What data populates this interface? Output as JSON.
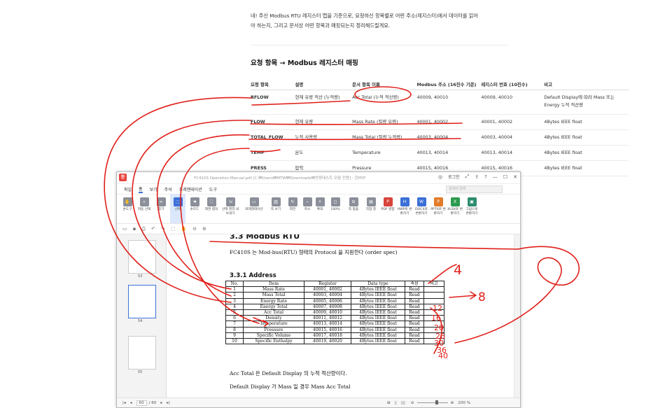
{
  "intro": {
    "line1": "네! 주신 Modbus RTU 레지스터 맵을 기준으로, 요청하신 항목별로 어떤 주소(레지스터)에서 데이터를 읽어",
    "line2": "야 하는지, 그리고 문서상 어떤 항목과 매핑되는지 정리해드릴게요."
  },
  "section_title": "요청 항목 → Modbus 레지스터 매핑",
  "mapping": {
    "headers": [
      "요청 항목",
      "설명",
      "문서 항목 이름",
      "Modbus 주소 (16진수 기준)",
      "레지스터 번호 (10진수)",
      "비고"
    ],
    "rows": [
      [
        "RFLOW",
        "현재 유량 적산 (누적량)",
        "Acc Total (누적 적산량)",
        "40009, 40010",
        "40009, 40010",
        "Default Display에 따라 Mass 또는 Energy 누적 적산량"
      ],
      [
        "FLOW",
        "현재 유량",
        "Mass Rate (질량 유량)",
        "40001, 40002",
        "40001, 40002",
        "4Bytes IEEE float"
      ],
      [
        "TOTAL_FLOW",
        "누적 사용량",
        "Mass Total (질량 누적량)",
        "40003, 40004",
        "40003, 40004",
        "4Bytes IEEE float"
      ],
      [
        "TEMP",
        "온도",
        "Temperature",
        "40013, 40014",
        "40013, 40014",
        "4Bytes IEEE float"
      ],
      [
        "PRESS",
        "압력",
        "Pressure",
        "40015, 40016",
        "40015, 40016",
        "4Bytes IEEE float"
      ]
    ]
  },
  "viewer": {
    "title": "FC410S Operation Manual.pdf [C:₩Users₩MTW₩Downloads₩연동테스트 모음 전용] - 한PDF",
    "login": "로그인",
    "search_placeholder": "검색어 입력",
    "menu": [
      "파일",
      "홈",
      "보기",
      "주석",
      "프레젠테이션",
      "도구"
    ],
    "ribbon": [
      {
        "label": "손도구",
        "icon": "hand-icon"
      },
      {
        "label": "자동 선택",
        "icon": "auto-select-icon"
      },
      {
        "label": "찾기",
        "icon": "binoculars-icon"
      },
      {
        "label": "선택",
        "icon": "select-icon"
      },
      {
        "label": "손모드",
        "icon": "hand-mode-icon"
      },
      {
        "label": "화면 캡처",
        "icon": "capture-icon"
      },
      {
        "label": "선택 영역 내보내기",
        "icon": "export-area-icon"
      },
      {
        "label": "프레젠테이션",
        "icon": "presentation-icon"
      },
      {
        "label": "쪽 보기",
        "icon": "page-view-icon"
      },
      {
        "label": "회전",
        "icon": "rotate-icon"
      },
      {
        "label": "축소",
        "icon": "zoom-out-icon"
      },
      {
        "label": "확대",
        "icon": "zoom-in-icon"
      },
      {
        "label": "100%",
        "icon": "zoom-100-icon"
      },
      {
        "label": "쪽 맞춤",
        "icon": "fit-page-icon"
      },
      {
        "label": "직업 창",
        "icon": "task-pane-icon"
      },
      {
        "label": "PDF 병합",
        "icon": "merge-icon"
      },
      {
        "label": "HWP로 변환하기",
        "icon": "hwp-icon"
      },
      {
        "label": "DOCX로 변환하기",
        "icon": "docx-icon"
      },
      {
        "label": "PPTX로 변환하기",
        "icon": "pptx-icon"
      },
      {
        "label": "XLSX로 변환하기",
        "icon": "xlsx-icon"
      },
      {
        "label": "그림으로 변환하기",
        "icon": "image-icon"
      }
    ],
    "thumb_pages": [
      "53",
      "54",
      "55"
    ],
    "status_page": "60",
    "status_total": "/ 60",
    "zoom": "200 %"
  },
  "doc": {
    "heading": "3.3 Modbus RTU",
    "para": "FC410S 는 Mod-bus(RTU) 형태의 Protocol 을 지원한다 (order spec)",
    "subheading": "3.3.1 Address",
    "table_headers": [
      "No.",
      "Item",
      "Register",
      "Data type",
      "속성",
      "비고"
    ],
    "table_rows": [
      [
        "1",
        "Mass Rate",
        "40001, 40002",
        "4Bytes IEEE float",
        "Read",
        ""
      ],
      [
        "2",
        "Mass Total",
        "40003, 40004",
        "4Bytes IEEE float",
        "Read",
        ""
      ],
      [
        "3",
        "Energy Rate",
        "40005, 40006",
        "4Bytes IEEE float",
        "Read",
        ""
      ],
      [
        "4",
        "Energy Total",
        "40007, 40008",
        "4Bytes IEEE float",
        "Read",
        ""
      ],
      [
        "5",
        "Acc Total",
        "40009, 40010",
        "4Bytes IEEE float",
        "Read",
        ""
      ],
      [
        "6",
        "Density",
        "40011, 40012",
        "4Bytes IEEE float",
        "Read",
        ""
      ],
      [
        "7",
        "Temperature",
        "40013, 40014",
        "4Bytes IEEE float",
        "Read",
        ""
      ],
      [
        "8",
        "Pressure",
        "40015, 40016",
        "4Bytes IEEE float",
        "Read",
        ""
      ],
      [
        "9",
        "Specific Volume",
        "40017, 40018",
        "4Bytes IEEE float",
        "Read",
        ""
      ],
      [
        "10",
        "Specific Enthalpy",
        "40019, 40020",
        "4Bytes IEEE float",
        "Read",
        ""
      ]
    ],
    "note1": "Acc Total 은 Default Display 의 누적 적산량이다.",
    "note2": "Default Display 가 Mass 일 경우 Mass Acc Total"
  },
  "handwriting": {
    "n4": "4",
    "n8": "8",
    "side_numbers": [
      "12",
      "16",
      "20",
      "26",
      "30",
      "36",
      "40"
    ]
  },
  "colors": {
    "ink": "#e0201a",
    "accent": "#3a73d8",
    "app_logo": "#e8423b"
  }
}
